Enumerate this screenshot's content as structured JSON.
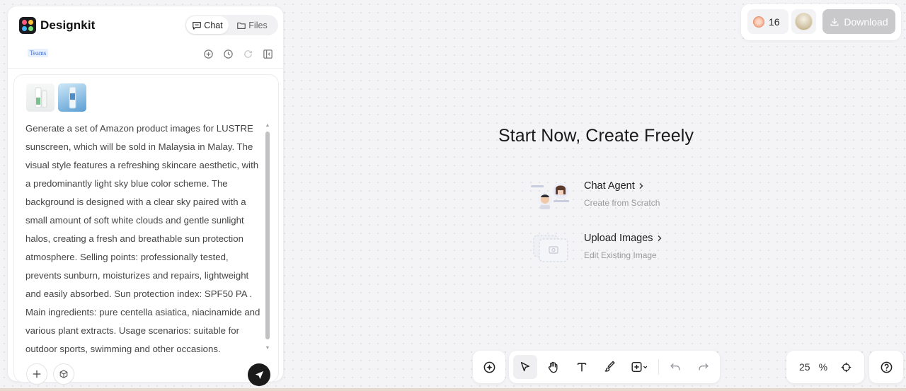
{
  "brand": {
    "name": "Designkit"
  },
  "panel_tabs": [
    {
      "label": "Chat",
      "icon": "chat-icon",
      "active": true
    },
    {
      "label": "Files",
      "icon": "folder-icon",
      "active": false
    }
  ],
  "teams_badge": "Teams",
  "prompt_text": "Generate a set of Amazon product images for LUSTRE sunscreen, which will be sold in Malaysia in Malay. The visual style features a refreshing skincare aesthetic, with a predominantly light sky blue color scheme. The background is designed with a clear sky paired with a small amount of soft white clouds and gentle sunlight halos, creating a fresh and breathable sun protection atmosphere. Selling points: professionally tested, prevents sunburn, moisturizes and repairs, lightweight and easily absorbed. Sun protection index: SPF50 PA . Main ingredients: pure centella asiatica, niacinamide and various plant extracts. Usage scenarios: suitable for outdoor sports, swimming and other occasions.",
  "topbar": {
    "credits": "16",
    "download_label": "Download"
  },
  "center": {
    "headline": "Start Now, Create Freely",
    "options": [
      {
        "title": "Chat Agent",
        "subtitle": "Create from Scratch"
      },
      {
        "title": "Upload Images",
        "subtitle": "Edit Existing Image"
      }
    ]
  },
  "zoom": {
    "value": "25",
    "unit": "%"
  },
  "colors": {
    "accent_dark": "#1a1a1a",
    "download_disabled": "#c9c9cc",
    "teams_badge": "#3b6fd4"
  }
}
